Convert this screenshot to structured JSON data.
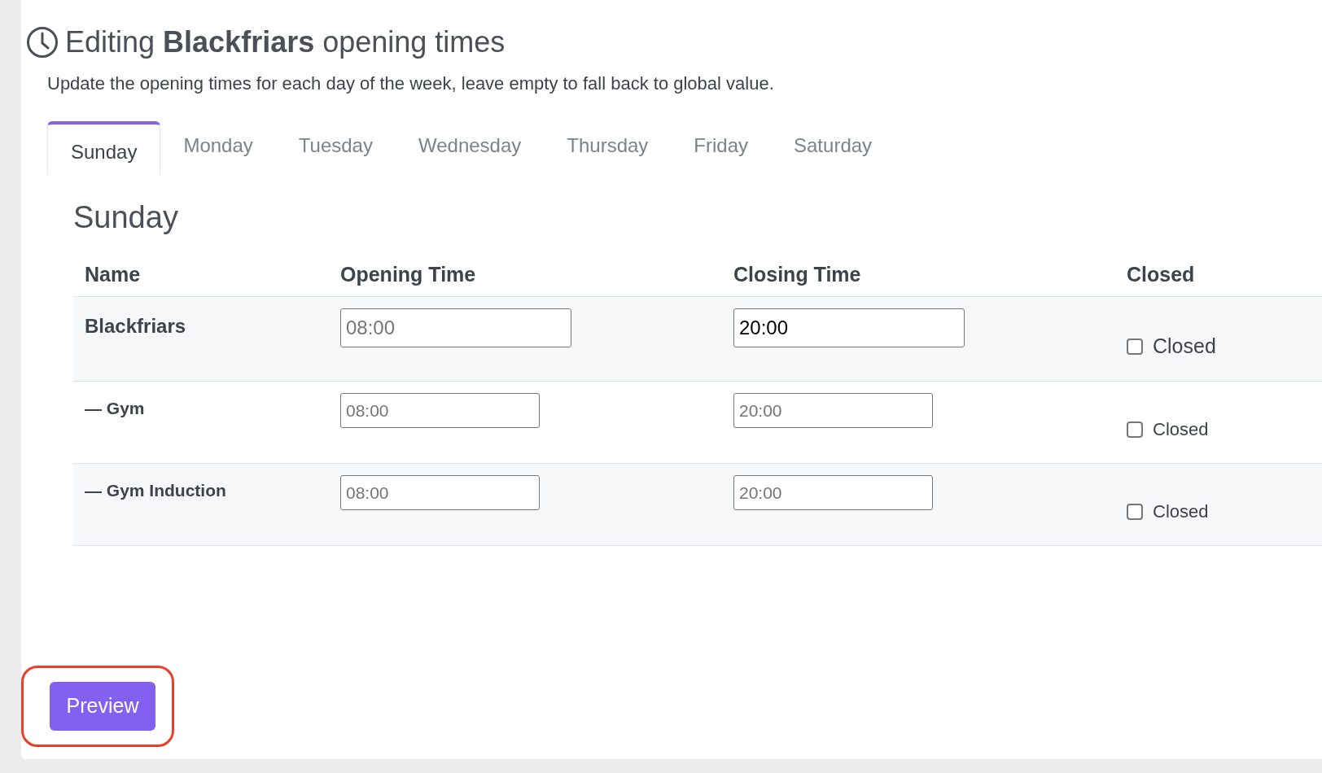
{
  "header": {
    "title": "Editing **Blackfriars** opening times",
    "subtitle": "Update the opening times for each day of the week, leave empty to fall back to global value."
  },
  "tabs": [
    {
      "label": "Sunday",
      "selected": true
    },
    {
      "label": "Monday",
      "selected": false
    },
    {
      "label": "Tuesday",
      "selected": false
    },
    {
      "label": "Wednesday",
      "selected": false
    },
    {
      "label": "Thursday",
      "selected": false
    },
    {
      "label": "Friday",
      "selected": false
    },
    {
      "label": "Saturday",
      "selected": false
    }
  ],
  "section_title": "Sunday",
  "table": {
    "columns": [
      "Name",
      "Opening Time",
      "Closing Time",
      "Closed"
    ],
    "rows": [
      {
        "kind": "location",
        "name": "Blackfriars",
        "opening": {
          "placeholder": "08:00"
        },
        "closing": {
          "value": "20:00"
        },
        "closed": {
          "label": "Closed",
          "checked": false
        }
      },
      {
        "kind": "sub",
        "name": "— Gym",
        "opening": {
          "placeholder": "08:00"
        },
        "closing": {
          "placeholder": "20:00"
        },
        "closed": {
          "label": "Closed",
          "checked": false
        }
      },
      {
        "kind": "sub",
        "name": "— Gym Induction",
        "opening": {
          "placeholder": "08:00"
        },
        "closing": {
          "placeholder": "20:00"
        },
        "closed": {
          "label": "Closed",
          "checked": false
        }
      }
    ]
  },
  "preview_button": {
    "label": "Preview",
    "highlighted": true
  }
}
